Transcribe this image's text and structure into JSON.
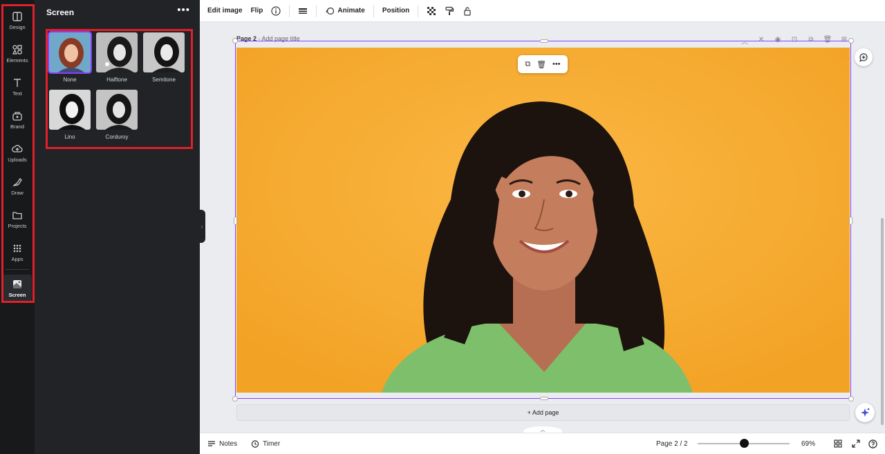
{
  "rail": {
    "items": [
      {
        "label": "Design",
        "icon": "design-icon"
      },
      {
        "label": "Elements",
        "icon": "elements-icon"
      },
      {
        "label": "Text",
        "icon": "text-icon"
      },
      {
        "label": "Brand",
        "icon": "brand-icon"
      },
      {
        "label": "Uploads",
        "icon": "uploads-icon"
      },
      {
        "label": "Draw",
        "icon": "draw-icon"
      },
      {
        "label": "Projects",
        "icon": "projects-icon"
      },
      {
        "label": "Apps",
        "icon": "apps-icon"
      },
      {
        "label": "Screen",
        "icon": "screen-icon",
        "active": true
      }
    ]
  },
  "panel": {
    "title": "Screen",
    "more": "•••",
    "effects": [
      {
        "label": "None",
        "style": "color",
        "selected": true
      },
      {
        "label": "Halftone",
        "style": "bw"
      },
      {
        "label": "Semitone",
        "style": "bw"
      },
      {
        "label": "Lino",
        "style": "bw"
      },
      {
        "label": "Corduroy",
        "style": "bw"
      }
    ]
  },
  "toolbar": {
    "edit_image": "Edit image",
    "flip": "Flip",
    "animate": "Animate",
    "position": "Position"
  },
  "page": {
    "name": "Page 2",
    "title_placeholder": " - Add page title"
  },
  "canvas": {
    "add_page": "+ Add page",
    "background": "#f8ae34"
  },
  "bottom": {
    "notes": "Notes",
    "timer": "Timer",
    "page_indicator": "Page 2 / 2",
    "zoom": "69%",
    "zoom_level": 0.55
  },
  "colors": {
    "accent": "#8b3dff",
    "highlight": "#e0202a"
  }
}
